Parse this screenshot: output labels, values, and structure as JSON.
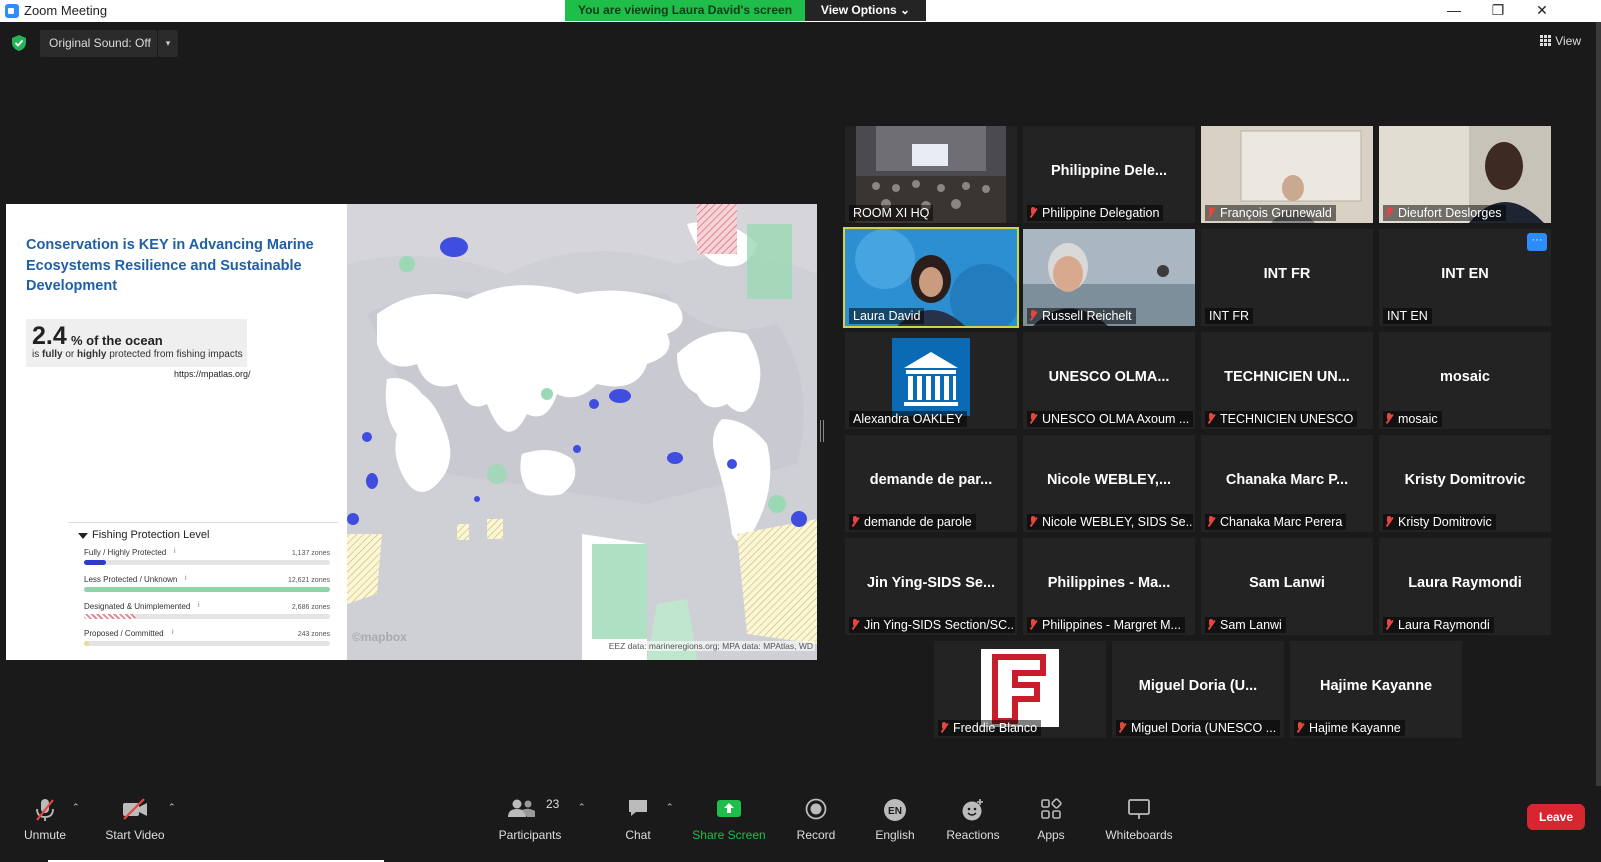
{
  "window": {
    "title": "Zoom Meeting",
    "minimize": "—",
    "maximize": "❐",
    "close": "✕"
  },
  "share_banner": {
    "text": "You are viewing Laura David's screen",
    "view_options": "View Options ⌄"
  },
  "top_controls": {
    "original_sound": "Original Sound: Off",
    "menu_caret": "▾",
    "view": "View"
  },
  "slide": {
    "title": "Conservation is KEY in Advancing Marine Ecosystems Resilience and Sustainable Development",
    "stat_value": "2.4",
    "stat_unit": "% of the ocean",
    "stat_desc_pre": "is ",
    "stat_desc_b1": "fully",
    "stat_desc_mid": " or ",
    "stat_desc_b2": "highly",
    "stat_desc_post": " protected from fishing impacts",
    "source": "https://mpatlas.org/",
    "legend": {
      "title": "Fishing Protection Level",
      "rows": [
        {
          "label": "Fully / Highly Protected",
          "info": "i",
          "count": "1,137 zones",
          "fill": 0.09,
          "color": "#2f39c4"
        },
        {
          "label": "Less Protected / Unknown",
          "info": "i",
          "count": "12,621 zones",
          "fill": 1.0,
          "color": "#8fd3aa"
        },
        {
          "label": "Designated & Unimplemented",
          "info": "i",
          "count": "2,686 zones",
          "fill": 0.21,
          "color": "#e38a9a"
        },
        {
          "label": "Proposed / Committed",
          "info": "i",
          "count": "243 zones",
          "fill": 0.02,
          "color": "#e8dc8a"
        }
      ]
    },
    "mapbox": "©mapbox",
    "attribution": "EEZ data: marineregions.org; MPA data: MPAtlas, WD"
  },
  "participants_gallery": [
    {
      "name": "ROOM XI HQ",
      "big": "",
      "muted": false,
      "video": "room"
    },
    {
      "name": "Philippine Delegation",
      "big": "Philippine  Dele...",
      "muted": true
    },
    {
      "name": "François Grunewald",
      "big": "",
      "muted": true,
      "video": "office"
    },
    {
      "name": "Dieufort Deslorges",
      "big": "",
      "muted": true,
      "video": "person"
    },
    {
      "name": "Laura David",
      "big": "",
      "muted": false,
      "video": "laura",
      "active": true
    },
    {
      "name": "Russell Reichelt",
      "big": "",
      "muted": true,
      "video": "beach"
    },
    {
      "name": "INT FR",
      "big": "INT FR",
      "muted": false
    },
    {
      "name": "INT EN",
      "big": "INT EN",
      "muted": false,
      "more": "···"
    },
    {
      "name": "Alexandra OAKLEY",
      "big": "",
      "muted": false,
      "video": "unesco"
    },
    {
      "name": "UNESCO OLMA Axoum ...",
      "big": "UNESCO  OLMA...",
      "muted": true
    },
    {
      "name": "TECHNICIEN UNESCO",
      "big": "TECHNICIEN  UN...",
      "muted": true
    },
    {
      "name": "mosaic",
      "big": "mosaic",
      "muted": true
    },
    {
      "name": "demande de parole",
      "big": "demande  de  par...",
      "muted": true
    },
    {
      "name": "Nicole WEBLEY, SIDS Se...",
      "big": "Nicole  WEBLEY,...",
      "muted": true
    },
    {
      "name": "Chanaka Marc Perera",
      "big": "Chanaka  Marc  P...",
      "muted": true
    },
    {
      "name": "Kristy Domitrovic",
      "big": "Kristy Domitrovic",
      "muted": true
    },
    {
      "name": "Jin Ying-SIDS Section/SC...",
      "big": "Jin  Ying-SIDS  Se...",
      "muted": true
    },
    {
      "name": "Philippines - Margret M...",
      "big": "Philippines  -  Ma...",
      "muted": true
    },
    {
      "name": "Sam Lanwi",
      "big": "Sam Lanwi",
      "muted": true
    },
    {
      "name": "Laura Raymondi",
      "big": "Laura Raymondi",
      "muted": true
    },
    {
      "name": "Freddie Blanco",
      "big": "",
      "muted": true,
      "video": "f-logo"
    },
    {
      "name": "Miguel Doria (UNESCO ...",
      "big": "Miguel  Doria  (U...",
      "muted": true
    },
    {
      "name": "Hajime Kayanne",
      "big": "Hajime Kayanne",
      "muted": true
    }
  ],
  "toolbar": {
    "unmute": "Unmute",
    "start_video": "Start Video",
    "participants": "Participants",
    "participant_count": "23",
    "chat": "Chat",
    "share_screen": "Share Screen",
    "record": "Record",
    "english": "English",
    "lang_code": "EN",
    "reactions": "Reactions",
    "apps": "Apps",
    "whiteboards": "Whiteboards",
    "leave": "Leave",
    "caret": "⌃"
  },
  "colors": {
    "share_green": "#1fbe4a",
    "active_speaker": "#d3d24a",
    "muted_red": "#e5463e",
    "leave_red": "#d7262f",
    "slide_title": "#1f5fa8"
  }
}
